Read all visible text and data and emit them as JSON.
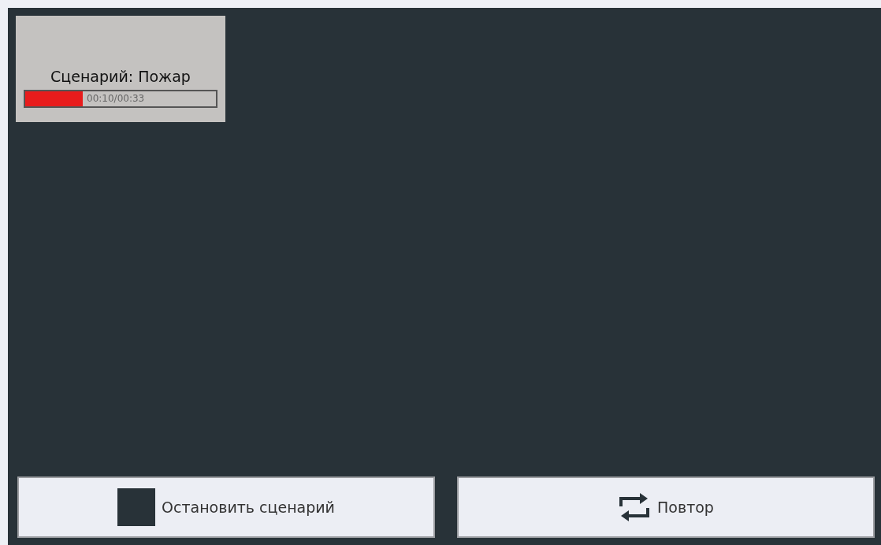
{
  "scenario_card": {
    "title": "Сценарий: Пожар",
    "progress": {
      "level": 0.3,
      "time": "00:10/00:33"
    }
  },
  "buttons": [
    {
      "kind": "stop",
      "label": "Остановить сценарий"
    },
    {
      "kind": "repeat",
      "label": "Повтор"
    }
  ]
}
